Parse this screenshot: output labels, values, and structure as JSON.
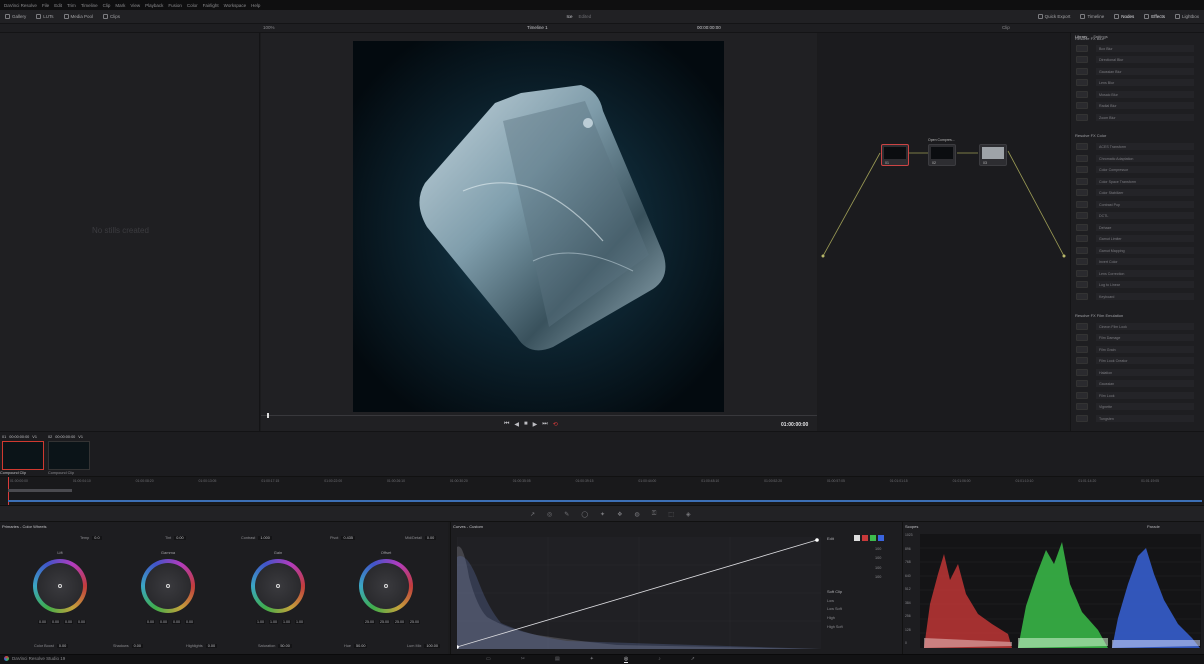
{
  "app": {
    "title": "DaVinci Resolve Studio 19",
    "menu": [
      "DaVinci Resolve",
      "File",
      "Edit",
      "Trim",
      "Timeline",
      "Clip",
      "Mark",
      "View",
      "Playback",
      "Fusion",
      "Color",
      "Fairlight",
      "Workspace",
      "Help"
    ]
  },
  "toolbar": {
    "gallery": "Gallery",
    "luts": "LUTs",
    "media_pool": "Media Pool",
    "clips": "Clips",
    "timeline": "Timeline 1",
    "project": "Ice",
    "edited": "Edited",
    "timecode": "00:00:00:00",
    "clip": "Clip",
    "quick_export": "Quick Export",
    "timeline_label": "Timeline",
    "nodes": "Nodes",
    "effects": "Effects",
    "lightbox": "Lightbox",
    "zoom": "100%"
  },
  "gallery": {
    "empty": "No stills created"
  },
  "viewer": {
    "timecode": "01:00:00:00"
  },
  "nodes": {
    "items": [
      {
        "label": "01",
        "sub": "Compound Clip"
      },
      {
        "label": "02",
        "sub": "Open Compres..."
      },
      {
        "label": "03",
        "sub": ""
      }
    ],
    "node2_title": "Open Compres..."
  },
  "library": {
    "tabs": [
      "Library",
      "Settings"
    ],
    "sections": [
      {
        "title": "Resolve FX Blur",
        "items": [
          "Box Blur",
          "Directional Blur",
          "Gaussian Blur",
          "Lens Blur",
          "Mosaic Blur",
          "Radial Blur",
          "Zoom Blur"
        ]
      },
      {
        "title": "Resolve FX Color",
        "items": [
          "ACES Transform",
          "Chromatic Adaptation",
          "Color Compressor",
          "Color Space Transform",
          "Color Stabilizer",
          "Contrast Pop",
          "DCTL",
          "Dehaze",
          "Gamut Limiter",
          "Gamut Mapping",
          "Invert Color",
          "Lens Correction",
          "Log to Linear",
          "Keyboard"
        ]
      },
      {
        "title": "Resolve FX Film Emulation",
        "items": [
          "Cineon Film Look",
          "Film Damage",
          "Film Grain",
          "Film Look Creator",
          "Halation",
          "Gaussian",
          "Film Look",
          "Vignette",
          "Tungsten"
        ]
      }
    ]
  },
  "clips": [
    {
      "num": "01",
      "tc": "00:00:00:00",
      "track": "V1",
      "name": "Compound Clip"
    },
    {
      "num": "02",
      "tc": "00:00:00:00",
      "track": "V1",
      "name": "Compound Clip"
    }
  ],
  "timeline_ruler": [
    "01:00:00:00",
    "01:00:04:10",
    "01:00:08:20",
    "01:00:13:05",
    "01:00:17:15",
    "01:00:22:00",
    "01:00:26:10",
    "01:00:30:20",
    "01:00:35:05",
    "01:00:39:15",
    "01:00:44:00",
    "01:00:48:10",
    "01:00:52:20",
    "01:00:57:05",
    "01:01:01:15",
    "01:01:06:00",
    "01:01:10:10",
    "01:01:14:20",
    "01:01:19:05"
  ],
  "wheels": {
    "panel_title": "Primaries - Color Wheels",
    "top_params": [
      {
        "label": "Temp",
        "value": "0.0"
      },
      {
        "label": "Tint",
        "value": "0.00"
      },
      {
        "label": "Contrast",
        "value": "1.000"
      },
      {
        "label": "Pivot",
        "value": "0.435"
      },
      {
        "label": "Mid/Detail",
        "value": "0.00"
      }
    ],
    "items": [
      {
        "name": "Lift",
        "vals": [
          "0.00",
          "0.00",
          "0.00",
          "0.00"
        ]
      },
      {
        "name": "Gamma",
        "vals": [
          "0.00",
          "0.00",
          "0.00",
          "0.00"
        ]
      },
      {
        "name": "Gain",
        "vals": [
          "1.00",
          "1.00",
          "1.00",
          "1.00"
        ]
      },
      {
        "name": "Offset",
        "vals": [
          "25.00",
          "25.00",
          "25.00",
          "25.00"
        ]
      }
    ],
    "bottom_params": [
      {
        "label": "Color Boost",
        "value": "0.00"
      },
      {
        "label": "Shadows",
        "value": "0.00"
      },
      {
        "label": "Highlights",
        "value": "0.00"
      },
      {
        "label": "Saturation",
        "value": "50.00"
      },
      {
        "label": "Hue",
        "value": "50.00"
      },
      {
        "label": "Lum Mix",
        "value": "100.00"
      }
    ]
  },
  "curves": {
    "title": "Curves - Custom",
    "edit_label": "Edit",
    "soft_clip": "Soft Clip",
    "channel_vals": [
      "100",
      "100",
      "100",
      "100"
    ],
    "soft_rows": [
      "Low",
      "Low Soft",
      "High",
      "High Soft"
    ]
  },
  "scopes": {
    "title": "Scopes",
    "mode": "Parade",
    "ticks": [
      "1023",
      "896",
      "768",
      "640",
      "512",
      "384",
      "256",
      "128",
      "0"
    ]
  },
  "colors": {
    "accent": "#d93b3b",
    "red": "#c8393a",
    "green": "#3dbb4c",
    "blue": "#3a64dd"
  }
}
